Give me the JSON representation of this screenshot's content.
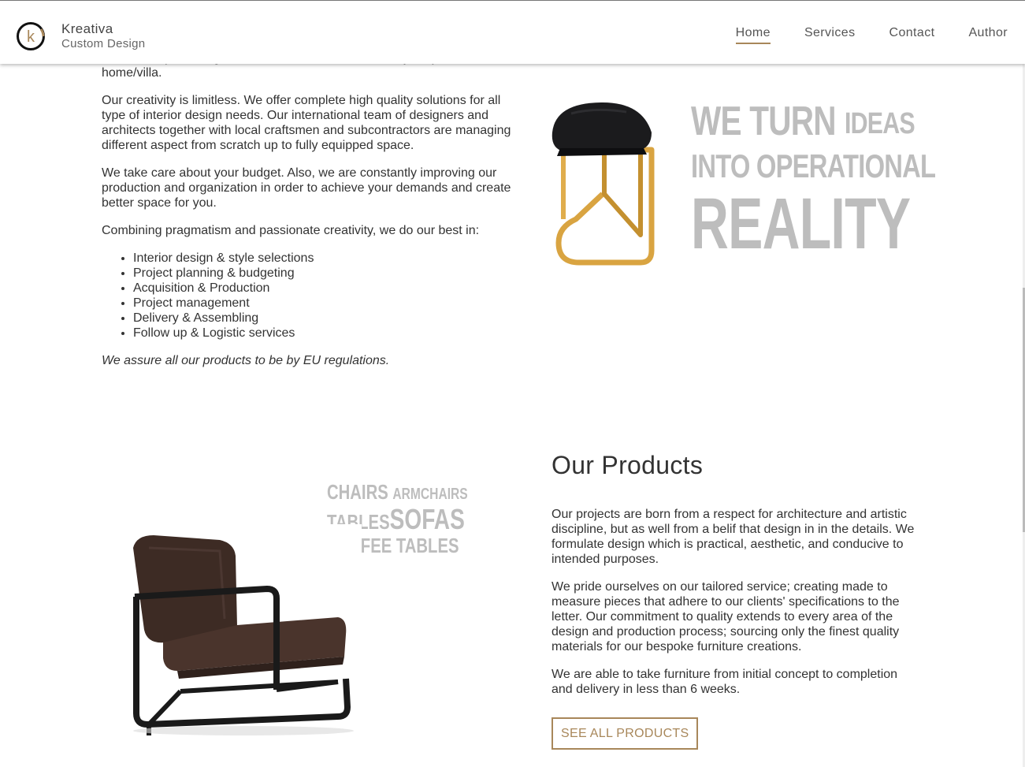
{
  "brand": {
    "name": "Kreativa",
    "tagline": "Custom Design",
    "logo_letter": "k",
    "accent": "#a8875a"
  },
  "nav": {
    "items": [
      {
        "label": "Home",
        "active": true
      },
      {
        "label": "Services",
        "active": false
      },
      {
        "label": "Contact",
        "active": false
      },
      {
        "label": "Author",
        "active": false
      }
    ]
  },
  "about": {
    "partial_first": "services in producing stores, offices, hotel furniture or your private home/villa.",
    "p2": "Our creativity is limitless. We offer complete high quality solutions for all type of interior design needs. Our international team of designers and architects together with local craftsmen and subcontractors are managing different aspect from scratch up to fully equipped space.",
    "p3": "We take care about your budget. Also, we are constantly improving our production and organization in order to achieve your demands and create better space for you.",
    "p4": "Combining pragmatism and passionate creativity, we do our best in:",
    "services": [
      "Interior design & style selections",
      "Project planning & budgeting",
      "Acquisition & Production",
      "Project management",
      "Delivery & Assembling",
      "Follow up & Logistic services"
    ],
    "note": "We assure all our products to be by EU regulations."
  },
  "hero_slogan": {
    "line1_big": "WE TURN",
    "line1_small": "IDEAS",
    "line2": "INTO OPERATIONAL",
    "line3": "REALITY"
  },
  "product_words": {
    "w1": "CHAIRS",
    "w2": "ARMCHAIRS",
    "w3": "TABLES",
    "w4": "SOFAS",
    "w5": "COFFEE TABLES"
  },
  "products": {
    "title": "Our Products",
    "p1": "Our projects are born from a respect for architecture and artistic discipline, but as well from a belif that design in in the details. We formulate design which is practical, aesthetic, and conducive to intended purposes.",
    "p2": "We pride ourselves on our tailored service; creating made to measure pieces that adhere to our clients' specifications to the letter. Our commitment to quality extends to every area of the design and production process; sourcing only the finest quality materials for our bespoke furniture creations.",
    "p3": "We are able to take furniture from initial concept to completion and delivery in less than 6 weeks.",
    "button": "SEE ALL PRODUCTS"
  }
}
